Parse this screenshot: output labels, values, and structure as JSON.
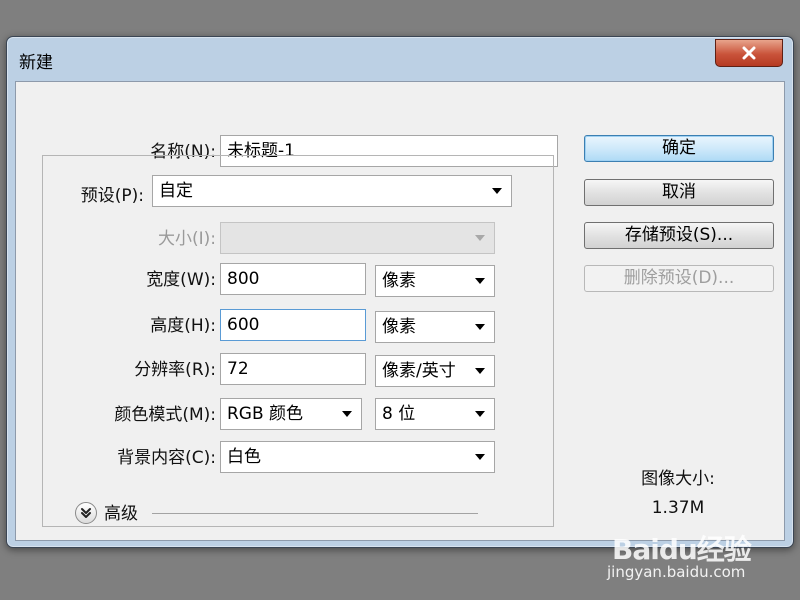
{
  "window": {
    "title": "新建"
  },
  "form": {
    "name": {
      "label": "名称(N):",
      "value": "未标题-1"
    },
    "preset": {
      "label": "预设(P):",
      "value": "自定"
    },
    "size": {
      "label": "大小(I):",
      "value": ""
    },
    "width": {
      "label": "宽度(W):",
      "value": "800",
      "unit": "像素"
    },
    "height": {
      "label": "高度(H):",
      "value": "600",
      "unit": "像素"
    },
    "resolution": {
      "label": "分辨率(R):",
      "value": "72",
      "unit": "像素/英寸"
    },
    "color_mode": {
      "label": "颜色模式(M):",
      "value": "RGB 颜色",
      "depth": "8 位"
    },
    "background": {
      "label": "背景内容(C):",
      "value": "白色"
    },
    "advanced": {
      "label": "高级"
    }
  },
  "buttons": {
    "ok": "确定",
    "cancel": "取消",
    "save_preset": "存储预设(S)...",
    "delete_preset": "删除预设(D)..."
  },
  "image_size": {
    "label": "图像大小:",
    "value": "1.37M"
  },
  "watermark": {
    "logo": "Baidu经验",
    "url": "jingyan.baidu.com"
  },
  "colors": {
    "default_button": "#aedaf5",
    "close_button": "#c9533a",
    "titlebar": "#bcd0e4"
  }
}
